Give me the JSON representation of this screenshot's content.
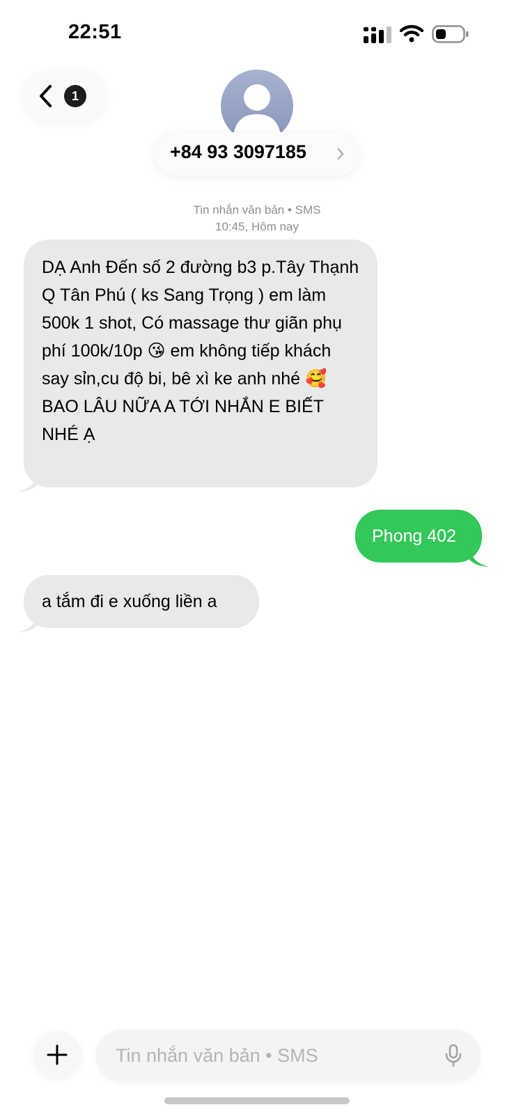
{
  "status_bar": {
    "time": "22:51"
  },
  "header": {
    "unread_count": "1",
    "contact_number": "+84 93 3097185"
  },
  "conversation": {
    "meta_line_1": "Tin nhắn văn bản • SMS",
    "meta_line_2": "10:45, Hôm nay",
    "messages": [
      {
        "direction": "incoming",
        "text": "DẠ Anh Đến số 2 đường b3 p.Tây Thạnh Q Tân Phú ( ks Sang Trọng ) em làm 500k 1 shot, Có massage thư giãn phụ phí 100k/10p 😘 em không tiếp khách say sỉn,cu độ bi, bê xì ke anh nhé 🥰\nBAO LÂU NỮA A TỚI NHẮN E BIẾT NHÉ Ạ"
      },
      {
        "direction": "outgoing",
        "text": "Phong 402"
      },
      {
        "direction": "incoming",
        "text": "a tắm đi e xuống liền a"
      }
    ]
  },
  "composer": {
    "placeholder": "Tin nhắn văn bản • SMS"
  },
  "colors": {
    "incoming_bubble": "#e9e9eb",
    "outgoing_bubble": "#34c759",
    "meta_text": "#8e8e93"
  },
  "icons": [
    "signal-icon",
    "wifi-icon",
    "battery-icon",
    "chevron-left-icon",
    "chevron-right-icon",
    "plus-icon",
    "mic-icon",
    "person-icon"
  ]
}
